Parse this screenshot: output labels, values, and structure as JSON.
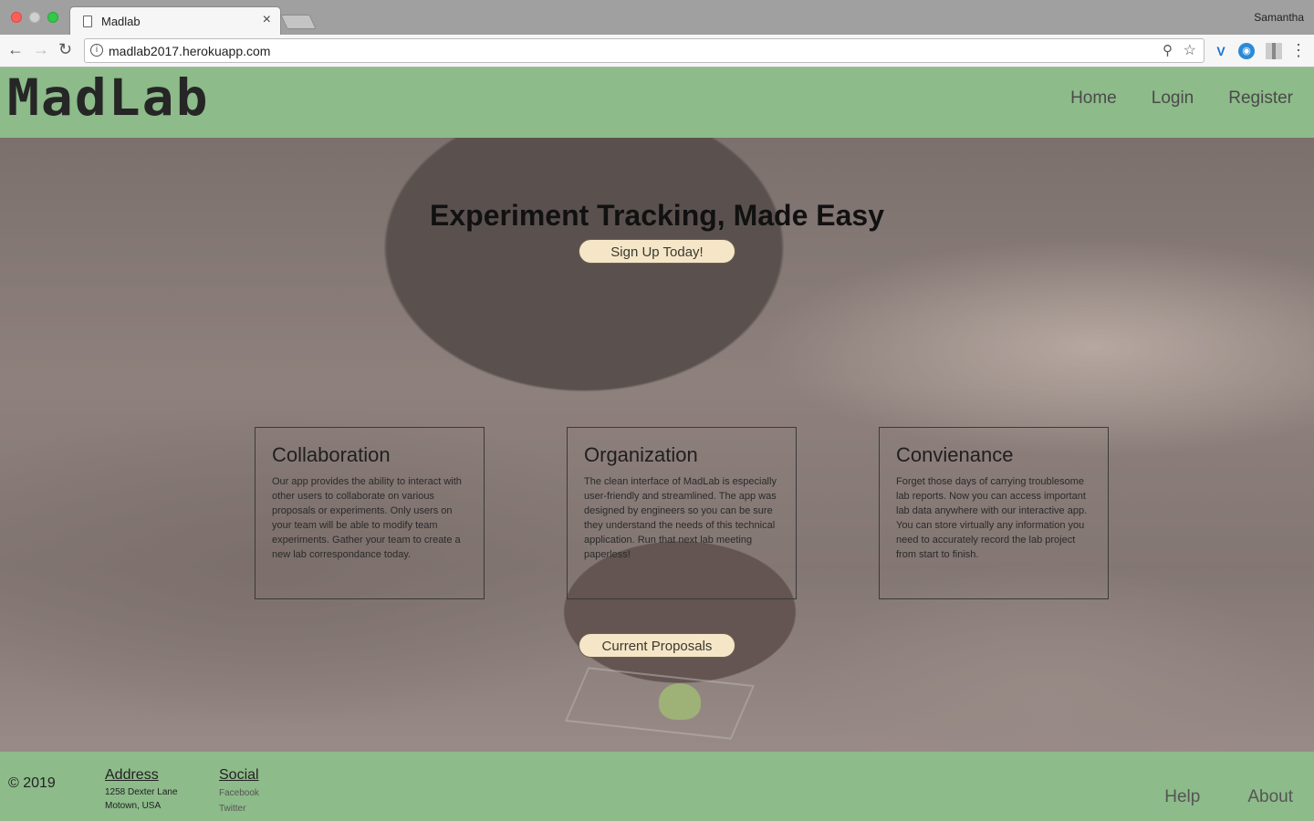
{
  "browser": {
    "tab_title": "Madlab",
    "tab_close": "×",
    "profile_name": "Samantha",
    "url": "madlab2017.herokuapp.com",
    "icons": [
      "back-icon",
      "forward-icon",
      "reload-icon",
      "info-icon",
      "zoom-icon",
      "star-icon",
      "extension-icon",
      "menu-icon"
    ]
  },
  "header": {
    "logo": "MadLab",
    "nav": {
      "home": "Home",
      "login": "Login",
      "register": "Register"
    }
  },
  "hero": {
    "title": "Experiment Tracking, Made Easy",
    "signup_button": "Sign Up Today!",
    "proposals_button": "Current Proposals"
  },
  "features": [
    {
      "title": "Collaboration",
      "body": "Our app provides the ability to interact with other users to collaborate on various proposals or experiments. Only users on your team will be able to modify team experiments. Gather your team to create a new lab correspondance today."
    },
    {
      "title": "Organization",
      "body": "The clean interface of MadLab is especially user-friendly and streamlined. The app was designed by engineers so you can be sure they understand the needs of this technical application. Run that next lab meeting paperless!"
    },
    {
      "title": "Convienance",
      "body": "Forget those days of carrying troublesome lab reports. Now you can access important lab data anywhere with our interactive app. You can store virtually any information you need to accurately record the lab project from start to finish."
    }
  ],
  "footer": {
    "copyright": "© 2019",
    "address": {
      "heading": "Address",
      "line1": "1258 Dexter Lane",
      "line2": "Motown, USA"
    },
    "social": {
      "heading": "Social",
      "facebook": "Facebook",
      "twitter": "Twitter"
    },
    "nav": {
      "help": "Help",
      "about": "About"
    }
  },
  "colors": {
    "header_green": "#8dbb8a",
    "button_cream": "#f6e6c8"
  }
}
